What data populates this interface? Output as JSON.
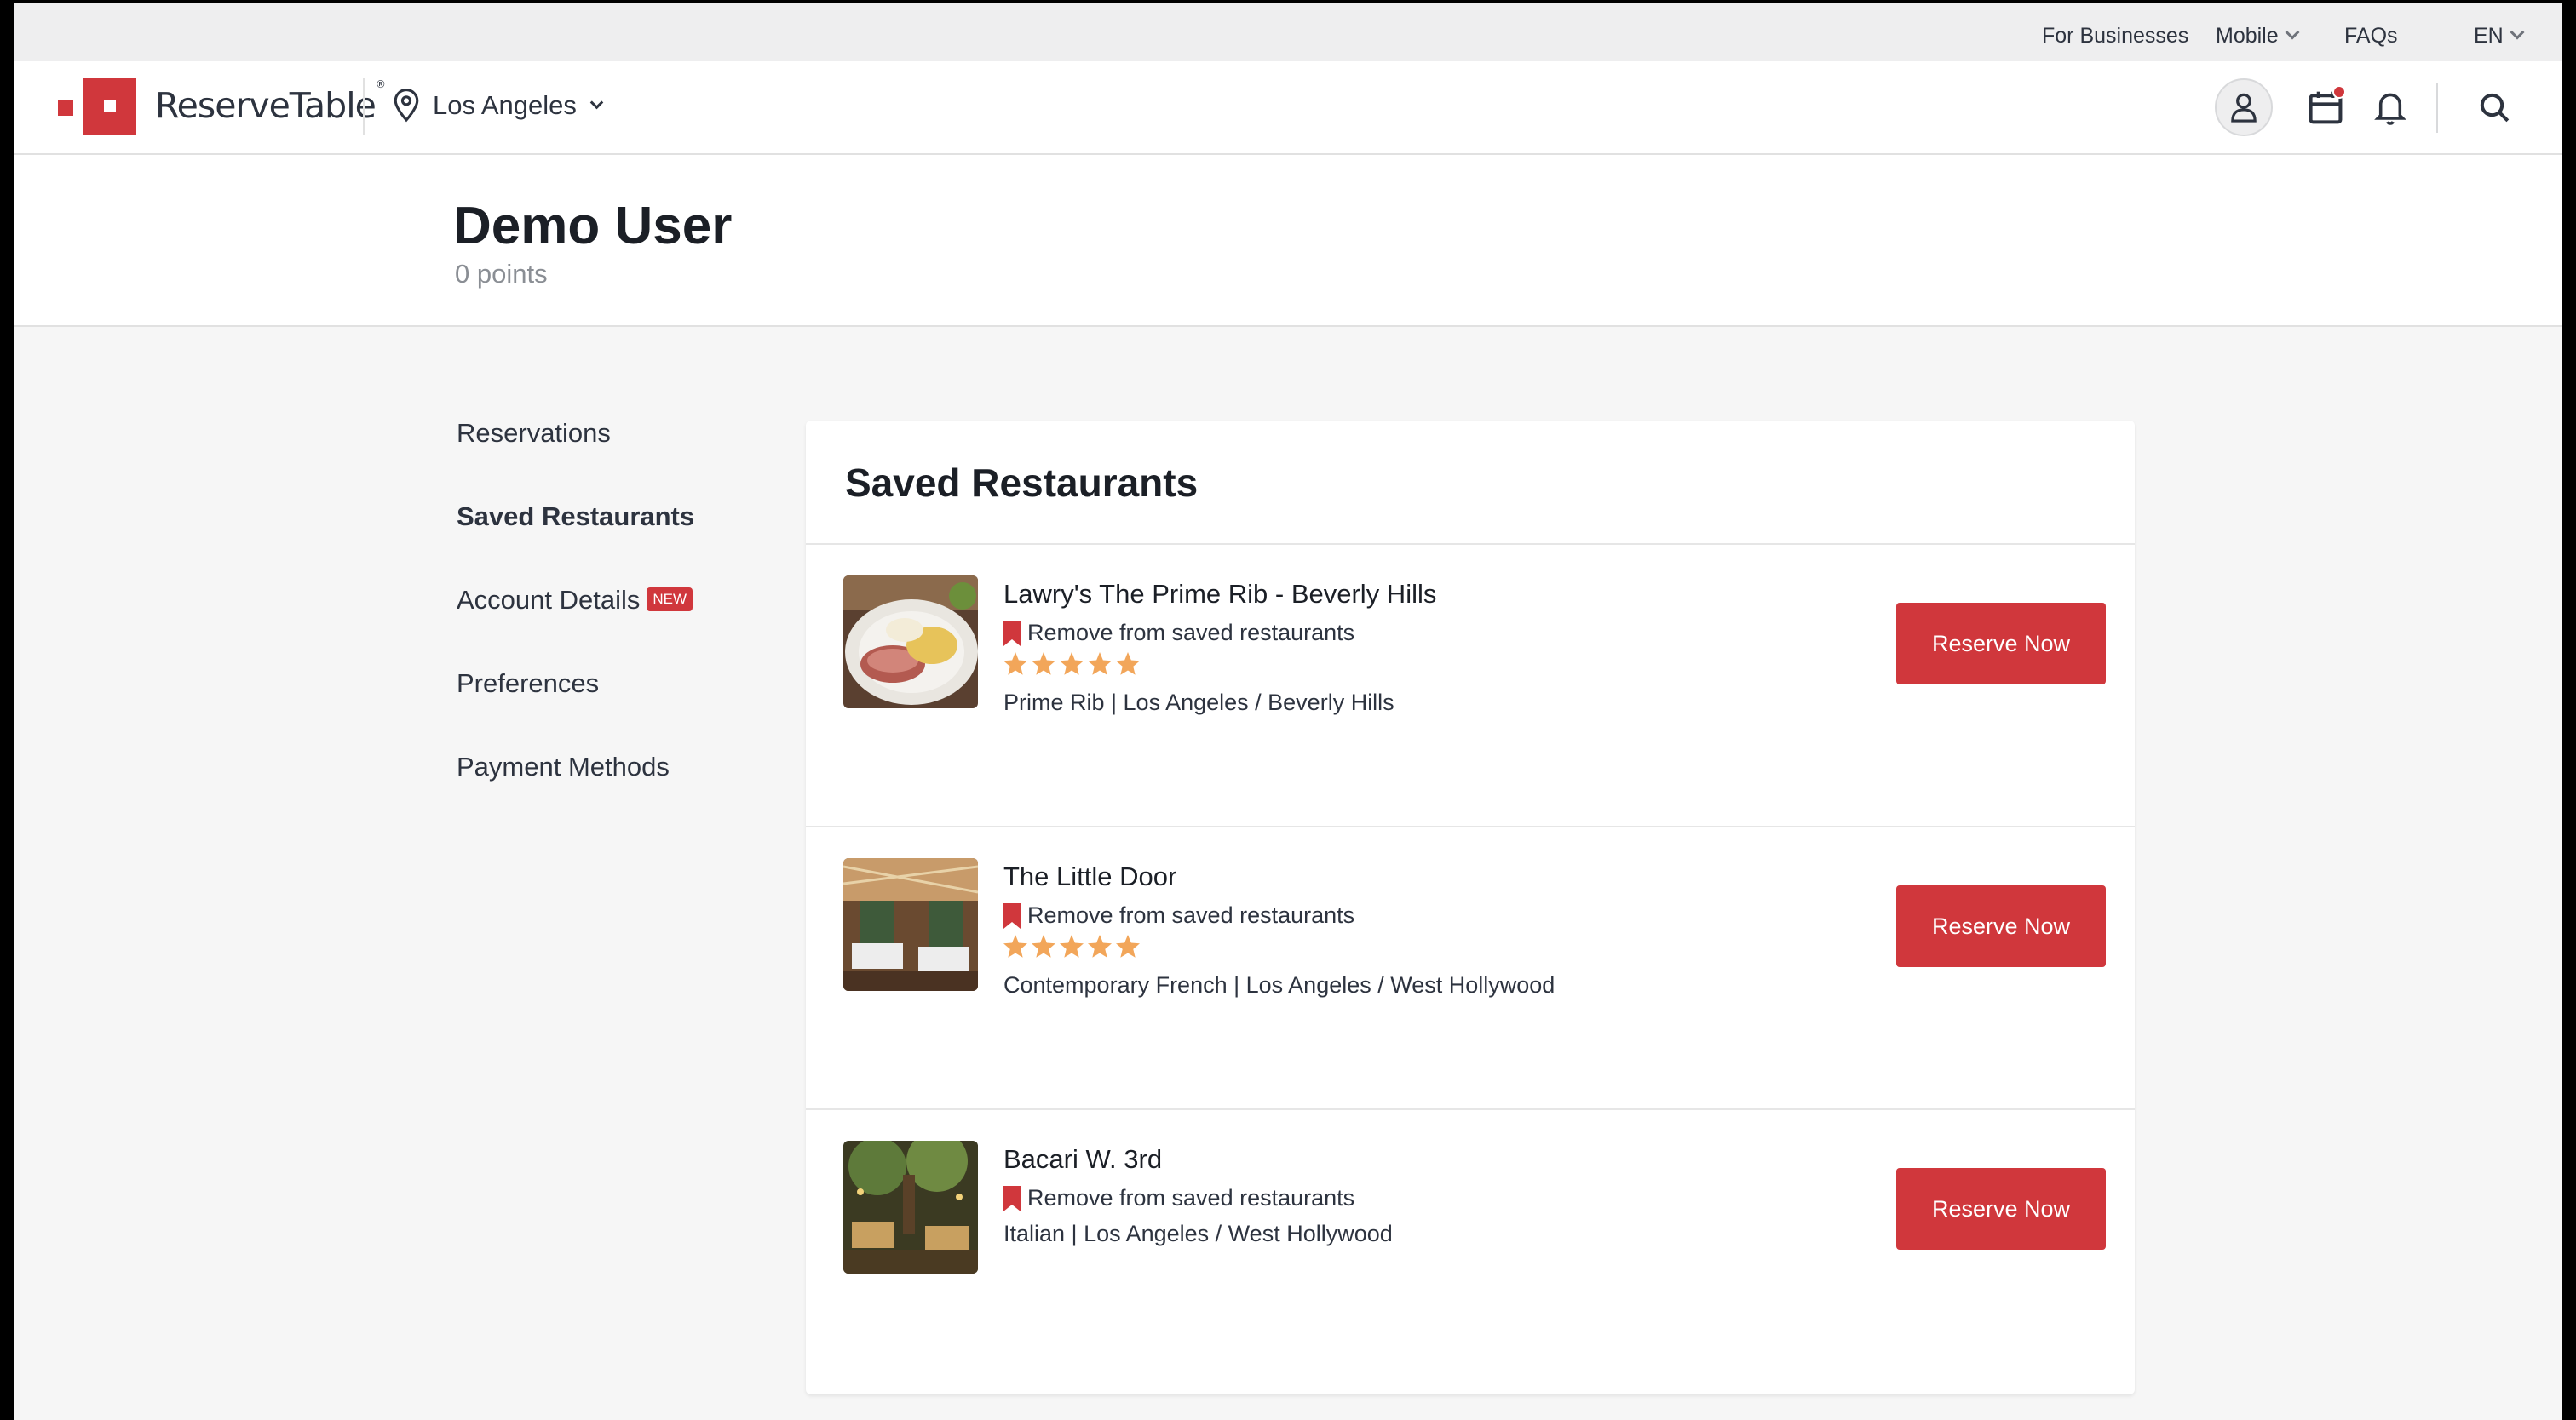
{
  "utility_bar": {
    "for_businesses": "For Businesses",
    "mobile": "Mobile",
    "faqs": "FAQs",
    "language": "EN"
  },
  "header": {
    "brand": "ReserveTable",
    "location": "Los Angeles",
    "icons": [
      "map-pin-icon",
      "user-icon",
      "calendar-icon",
      "bell-icon",
      "search-icon"
    ]
  },
  "profile": {
    "name": "Demo User",
    "points": "0 points"
  },
  "sidenav": {
    "items": [
      {
        "label": "Reservations"
      },
      {
        "label": "Saved Restaurants"
      },
      {
        "label": "Account Details",
        "badge": "NEW"
      },
      {
        "label": "Preferences"
      },
      {
        "label": "Payment Methods"
      }
    ]
  },
  "saved": {
    "title": "Saved Restaurants",
    "restaurants": [
      {
        "name": "Lawry's The Prime Rib - Beverly Hills",
        "remove_label": "Remove from saved restaurants",
        "rating": 5,
        "meta": "Prime Rib | Los Angeles / Beverly Hills",
        "button": "Reserve Now"
      },
      {
        "name": "The Little Door",
        "remove_label": "Remove from saved restaurants",
        "rating": 5,
        "meta": "Contemporary French | Los Angeles / West Hollywood",
        "button": "Reserve Now"
      },
      {
        "name": "Bacari W. 3rd",
        "remove_label": "Remove from saved restaurants",
        "meta": "Italian | Los Angeles / West Hollywood",
        "button": "Reserve Now"
      }
    ]
  },
  "colors": {
    "brand_red": "#d0373c",
    "star_orange": "#f2a65a"
  }
}
